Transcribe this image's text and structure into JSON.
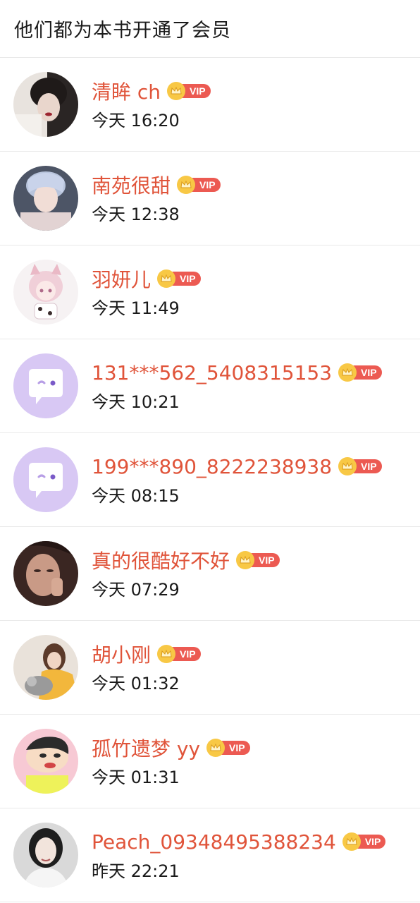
{
  "header": {
    "title": "他们都为本书开通了会员"
  },
  "vip_label": "VIP",
  "colors": {
    "name": "#e0543a",
    "vip_tag": "#ec5a52",
    "crown": "#f8c845"
  },
  "members": [
    {
      "name": "清眸 ch",
      "time": "今天 16:20",
      "avatar": "photo-dark"
    },
    {
      "name": "南苑很甜",
      "time": "今天 12:38",
      "avatar": "photo-blue-hair"
    },
    {
      "name": "羽妍儿",
      "time": "今天 11:49",
      "avatar": "anime-pink"
    },
    {
      "name": "131***562_5408315153",
      "time": "今天 10:21",
      "avatar": "default-chat"
    },
    {
      "name": "199***890_8222238938",
      "time": "今天 08:15",
      "avatar": "default-chat"
    },
    {
      "name": "真的很酷好不好",
      "time": "今天 07:29",
      "avatar": "photo-face"
    },
    {
      "name": "胡小刚",
      "time": "今天 01:32",
      "avatar": "photo-cat"
    },
    {
      "name": "孤竹遗梦 yy",
      "time": "今天 01:31",
      "avatar": "cartoon-shinchan"
    },
    {
      "name": "Peach_09348495388234",
      "time": "昨天 22:21",
      "avatar": "photo-girl"
    }
  ]
}
